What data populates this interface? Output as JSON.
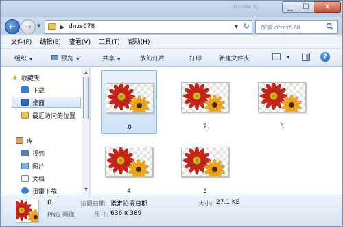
{
  "window": {
    "title_ghost": "...ansiwang..."
  },
  "address_bar": {
    "path": "dnzs678"
  },
  "search": {
    "placeholder": "搜索 dnzs678"
  },
  "menu": [
    "文件(F)",
    "编辑(E)",
    "查看(V)",
    "工具(T)",
    "帮助(H)"
  ],
  "toolbar": {
    "organize": "组织",
    "preview": "预览",
    "share": "共享",
    "slideshow": "放幻灯片",
    "print": "打印",
    "new_folder": "新建文件夹"
  },
  "navigation": {
    "favorites_header": "收藏夹",
    "favorites": [
      "下载",
      "桌面",
      "最近访问的位置"
    ],
    "library_header": "库",
    "libraries": [
      "视频",
      "图片",
      "文档",
      "迅雷下载"
    ]
  },
  "files": [
    {
      "name": "0",
      "selected": true
    },
    {
      "name": "2",
      "selected": false
    },
    {
      "name": "3",
      "selected": false
    },
    {
      "name": "4",
      "selected": false
    },
    {
      "name": "5",
      "selected": false
    }
  ],
  "details": {
    "name": "0",
    "type": "PNG 图像",
    "date_label": "拍摄日期:",
    "date_value": "指定拍摄日期",
    "dims_label": "尺寸:",
    "dims_value": "636 x 389",
    "size_label": "大小:",
    "size_value": "27.1 KB"
  },
  "colors": {
    "accent": "#1c5aa8",
    "selection": "#cfe2f8",
    "flower_red": "#c4261b",
    "flower_yellow": "#f0a818"
  }
}
